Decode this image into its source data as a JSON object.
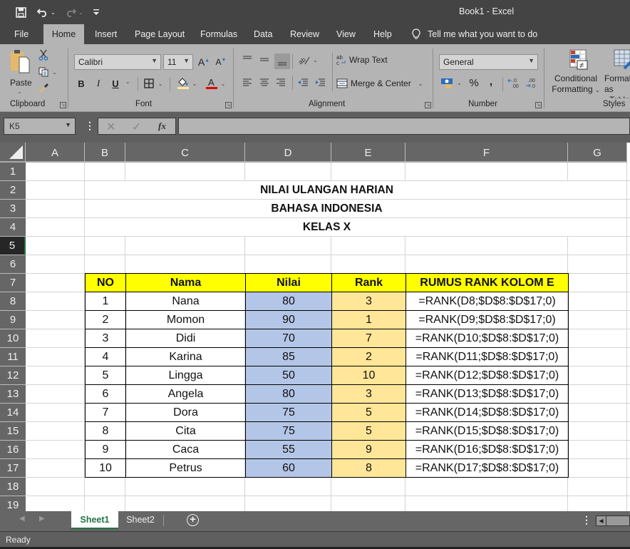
{
  "window": {
    "title": "Book1  -  Excel"
  },
  "qat": {
    "save": "save-icon",
    "undo": "undo-icon",
    "redo": "redo-icon",
    "customize": "customize-qat-icon"
  },
  "menu": {
    "tabs": [
      "File",
      "Home",
      "Insert",
      "Page Layout",
      "Formulas",
      "Data",
      "Review",
      "View",
      "Help"
    ],
    "active": "Home",
    "tell_me": "Tell me what you want to do"
  },
  "ribbon": {
    "clipboard": {
      "label": "Clipboard",
      "paste": "Paste"
    },
    "font": {
      "label": "Font",
      "name": "Calibri",
      "size": "11",
      "bold": "B",
      "italic": "I",
      "underline": "U",
      "fill_color": "#ffe699",
      "font_color": "#e00000"
    },
    "alignment": {
      "label": "Alignment",
      "wrap_text": "Wrap Text",
      "merge_center": "Merge & Center"
    },
    "number": {
      "label": "Number",
      "format": "General",
      "percent": "%",
      "comma": ","
    },
    "styles": {
      "label": "Styles",
      "conditional_formatting_1": "Conditional",
      "conditional_formatting_2": "Formatting",
      "format_table_1": "Format as",
      "format_table_2": "Table"
    }
  },
  "formula_bar": {
    "name_box": "K5",
    "formula": "",
    "fx": "fx"
  },
  "columns": [
    "A",
    "B",
    "C",
    "D",
    "E",
    "F",
    "G"
  ],
  "rows": [
    "1",
    "2",
    "3",
    "4",
    "5",
    "6",
    "7",
    "8",
    "9",
    "10",
    "11",
    "12",
    "13",
    "14",
    "15",
    "16",
    "17",
    "18",
    "19"
  ],
  "selected_cell": "K5",
  "sheet_titles": [
    "NILAI ULANGAN HARIAN",
    "BAHASA INDONESIA",
    "KELAS X"
  ],
  "table": {
    "headers": [
      "NO",
      "Nama",
      "Nilai",
      "Rank",
      "RUMUS RANK KOLOM E"
    ],
    "rows": [
      {
        "no": "1",
        "nama": "Nana",
        "nilai": "80",
        "rank": "3",
        "rumus": "=RANK(D8;$D$8:$D$17;0)"
      },
      {
        "no": "2",
        "nama": "Momon",
        "nilai": "90",
        "rank": "1",
        "rumus": "=RANK(D9;$D$8:$D$17;0)"
      },
      {
        "no": "3",
        "nama": "Didi",
        "nilai": "70",
        "rank": "7",
        "rumus": "=RANK(D10;$D$8:$D$17;0)"
      },
      {
        "no": "4",
        "nama": "Karina",
        "nilai": "85",
        "rank": "2",
        "rumus": "=RANK(D11;$D$8:$D$17;0)"
      },
      {
        "no": "5",
        "nama": "Lingga",
        "nilai": "50",
        "rank": "10",
        "rumus": "=RANK(D12;$D$8:$D$17;0)"
      },
      {
        "no": "6",
        "nama": "Angela",
        "nilai": "80",
        "rank": "3",
        "rumus": "=RANK(D13;$D$8:$D$17;0)"
      },
      {
        "no": "7",
        "nama": "Dora",
        "nilai": "75",
        "rank": "5",
        "rumus": "=RANK(D14;$D$8:$D$17;0)"
      },
      {
        "no": "8",
        "nama": "Cita",
        "nilai": "75",
        "rank": "5",
        "rumus": "=RANK(D15;$D$8:$D$17;0)"
      },
      {
        "no": "9",
        "nama": "Caca",
        "nilai": "55",
        "rank": "9",
        "rumus": "=RANK(D16;$D$8:$D$17;0)"
      },
      {
        "no": "10",
        "nama": "Petrus",
        "nilai": "60",
        "rank": "8",
        "rumus": "=RANK(D17;$D$8:$D$17;0)"
      }
    ]
  },
  "sheets": {
    "tabs": [
      "Sheet1",
      "Sheet2"
    ],
    "active": "Sheet1",
    "add": "+"
  },
  "status": {
    "text": "Ready"
  },
  "colors": {
    "accent": "#217346",
    "header_fill": "#ffff00",
    "nilai_fill": "#b4c6e7",
    "rank_fill": "#ffe699"
  }
}
